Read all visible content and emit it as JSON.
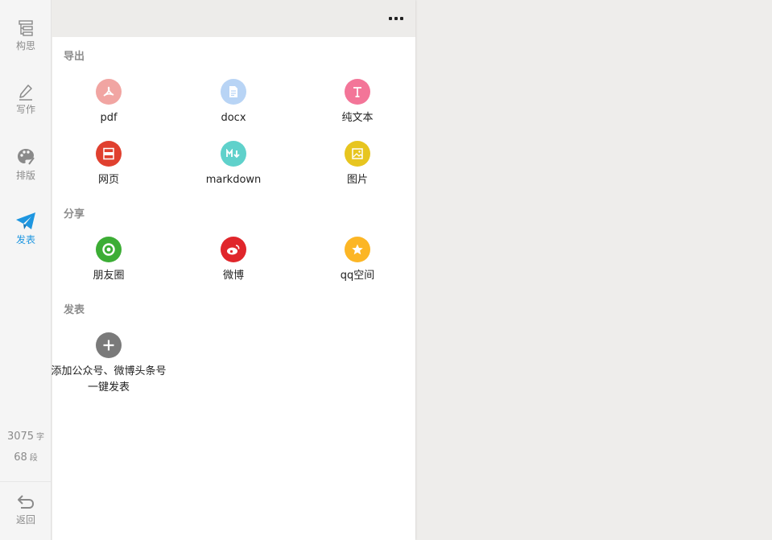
{
  "sidebar": {
    "items": [
      {
        "label": "构思",
        "icon": "outline-icon"
      },
      {
        "label": "写作",
        "icon": "pencil-icon"
      },
      {
        "label": "排版",
        "icon": "palette-icon"
      },
      {
        "label": "发表",
        "icon": "paper-plane-icon",
        "active": true
      }
    ],
    "word_count": "3075",
    "word_unit": "字",
    "paragraph_count": "68",
    "paragraph_unit": "段",
    "back_label": "返回",
    "active_color": "#1e96e0"
  },
  "panel": {
    "export": {
      "title": "导出",
      "items": [
        {
          "label": "pdf",
          "icon": "pdf-icon",
          "color": "#f1a5a2"
        },
        {
          "label": "docx",
          "icon": "docx-icon",
          "color": "#b8d4f5"
        },
        {
          "label": "纯文本",
          "icon": "text-t-icon",
          "color": "#f37598"
        },
        {
          "label": "网页",
          "icon": "html-icon",
          "color": "#e0402f"
        },
        {
          "label": "markdown",
          "icon": "markdown-icon",
          "color": "#5fd1cb"
        },
        {
          "label": "图片",
          "icon": "image-icon",
          "color": "#e7c51f"
        }
      ]
    },
    "share": {
      "title": "分享",
      "items": [
        {
          "label": "朋友圈",
          "icon": "moments-icon",
          "color": "#3cad35"
        },
        {
          "label": "微博",
          "icon": "weibo-icon",
          "color": "#e0262b"
        },
        {
          "label": "qq空间",
          "icon": "qzone-star-icon",
          "color": "#fcb625"
        }
      ]
    },
    "publish": {
      "title": "发表",
      "add_label_line1": "添加公众号、微博头条号",
      "add_label_line2": "一键发表",
      "add_color": "#7a7a7a"
    }
  }
}
